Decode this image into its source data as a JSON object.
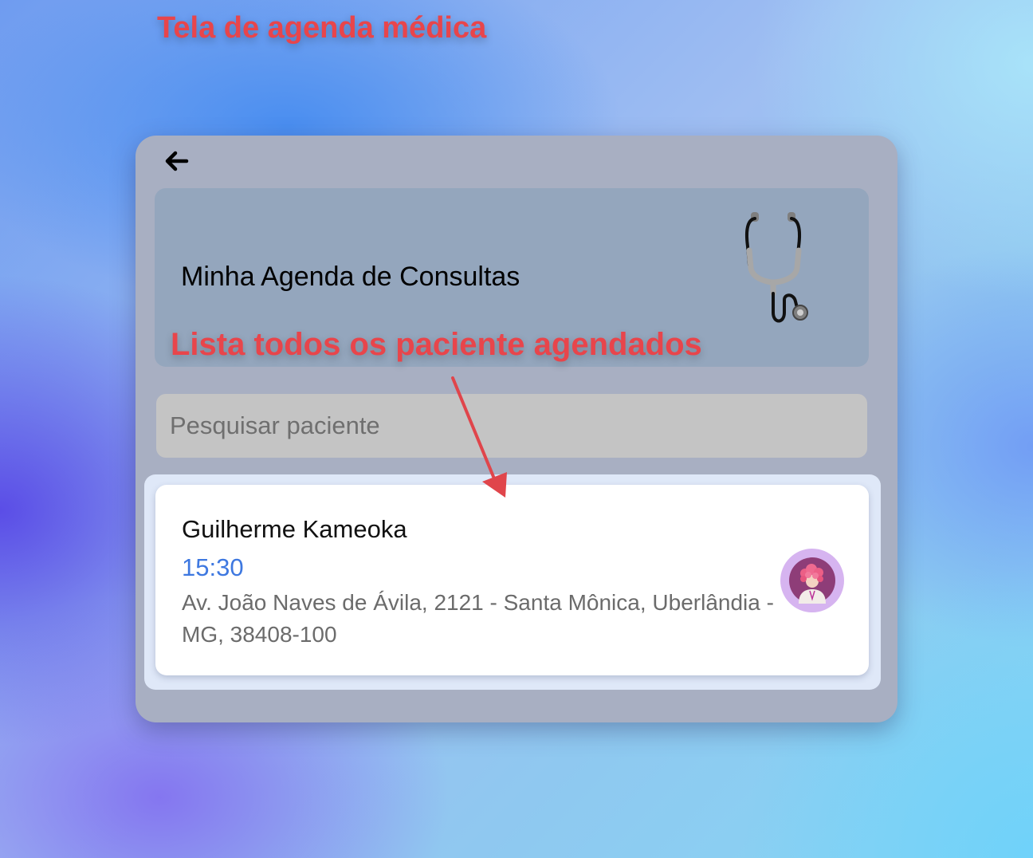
{
  "annotations": {
    "screen_title": "Tela de agenda médica",
    "list_note": "Lista todos os paciente agendados",
    "color": "#e8454b"
  },
  "header": {
    "back_icon": "arrow-left-icon",
    "title": "Minha Agenda de Consultas",
    "illustration_icon": "stethoscope-icon"
  },
  "search": {
    "placeholder": "Pesquisar paciente",
    "value": ""
  },
  "appointments": [
    {
      "patient_name": "Guilherme Kameoka",
      "time": "15:30",
      "address": "Av. João Naves de Ávila, 2121 - Santa Mônica, Uberlândia - MG, 38408-100",
      "avatar_icon": "doctor-avatar-icon"
    }
  ],
  "colors": {
    "accent_time": "#3e78e0",
    "window_bg": "#a8afc2",
    "header_bg": "#94a6bd",
    "avatar_bg": "#d6b4f0"
  }
}
